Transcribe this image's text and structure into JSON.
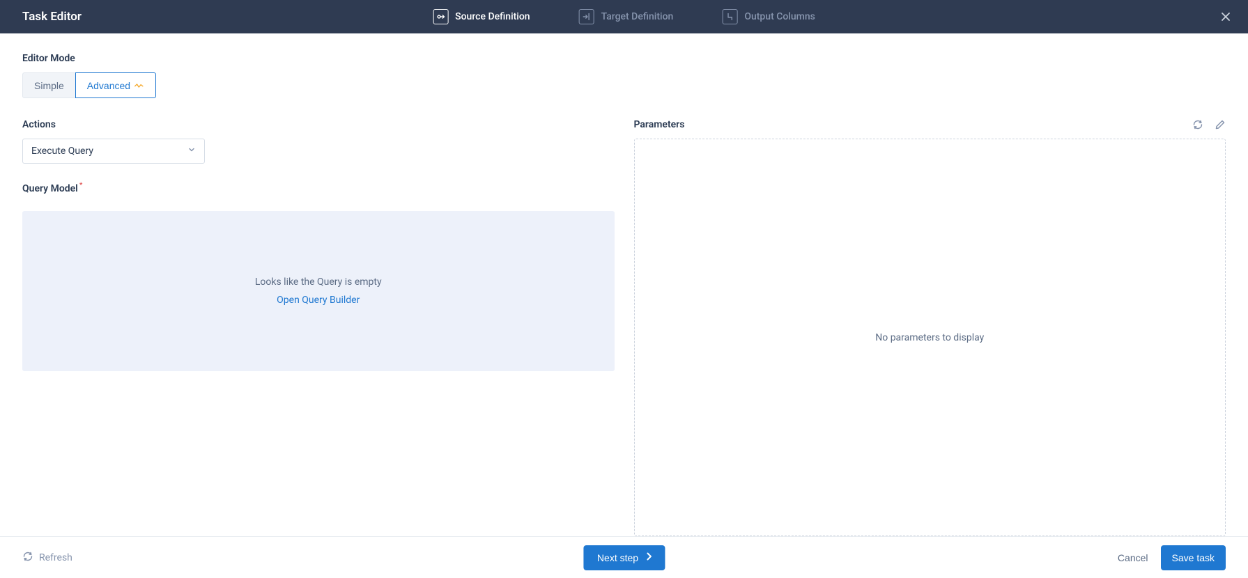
{
  "header": {
    "title": "Task Editor",
    "steps": [
      {
        "label": "Source Definition",
        "active": true
      },
      {
        "label": "Target Definition",
        "active": false
      },
      {
        "label": "Output Columns",
        "active": false
      }
    ]
  },
  "editor_mode": {
    "label": "Editor Mode",
    "options": {
      "simple": "Simple",
      "advanced": "Advanced"
    },
    "selected": "advanced"
  },
  "actions": {
    "label": "Actions",
    "selected": "Execute Query"
  },
  "query_model": {
    "label": "Query Model",
    "empty_text": "Looks like the Query is empty",
    "link_text": "Open Query Builder"
  },
  "parameters": {
    "label": "Parameters",
    "empty_text": "No parameters to display"
  },
  "footer": {
    "refresh": "Refresh",
    "next": "Next step",
    "cancel": "Cancel",
    "save": "Save task"
  }
}
